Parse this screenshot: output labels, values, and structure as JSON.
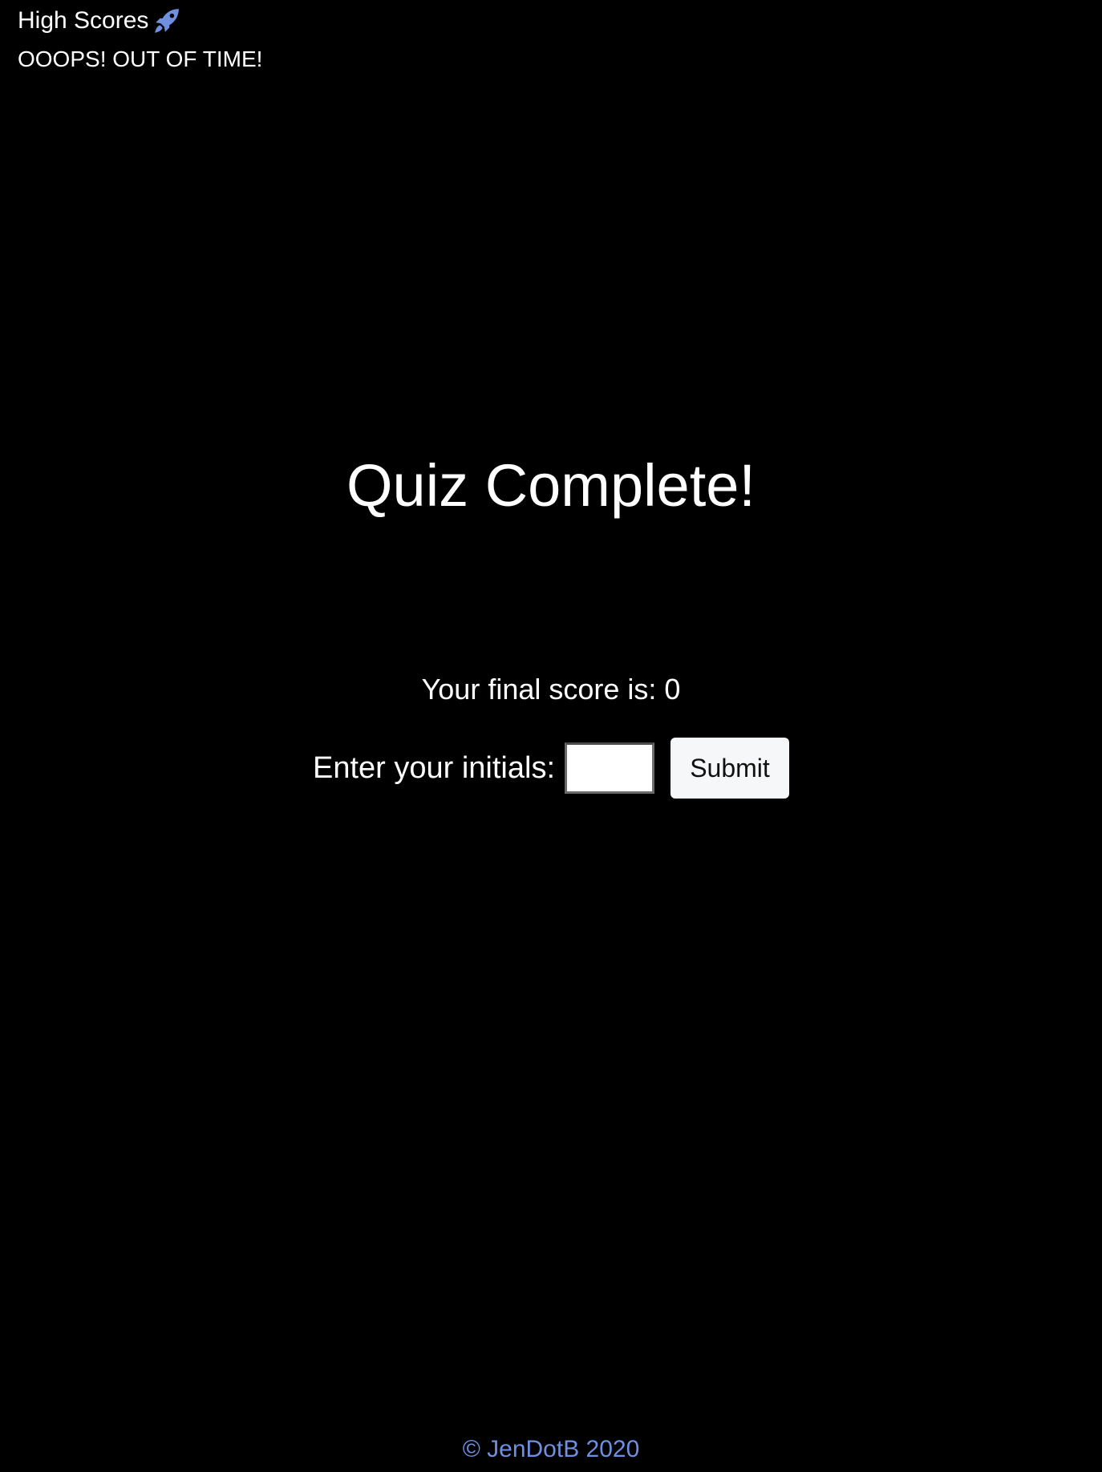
{
  "header": {
    "high_scores_label": "High Scores",
    "high_scores_icon": "rocket-icon",
    "timer_message": "OOOPS! OUT OF TIME!"
  },
  "main": {
    "title": "Quiz Complete!",
    "final_score_text": "Your final score is: 0",
    "initials_label": "Enter your initials:",
    "initials_value": "",
    "submit_label": "Submit"
  },
  "footer": {
    "copyright": "© JenDotB 2020"
  },
  "colors": {
    "background": "#000000",
    "text": "#ffffff",
    "accent": "#6f8fe0",
    "button_bg": "#f6f7f8"
  }
}
